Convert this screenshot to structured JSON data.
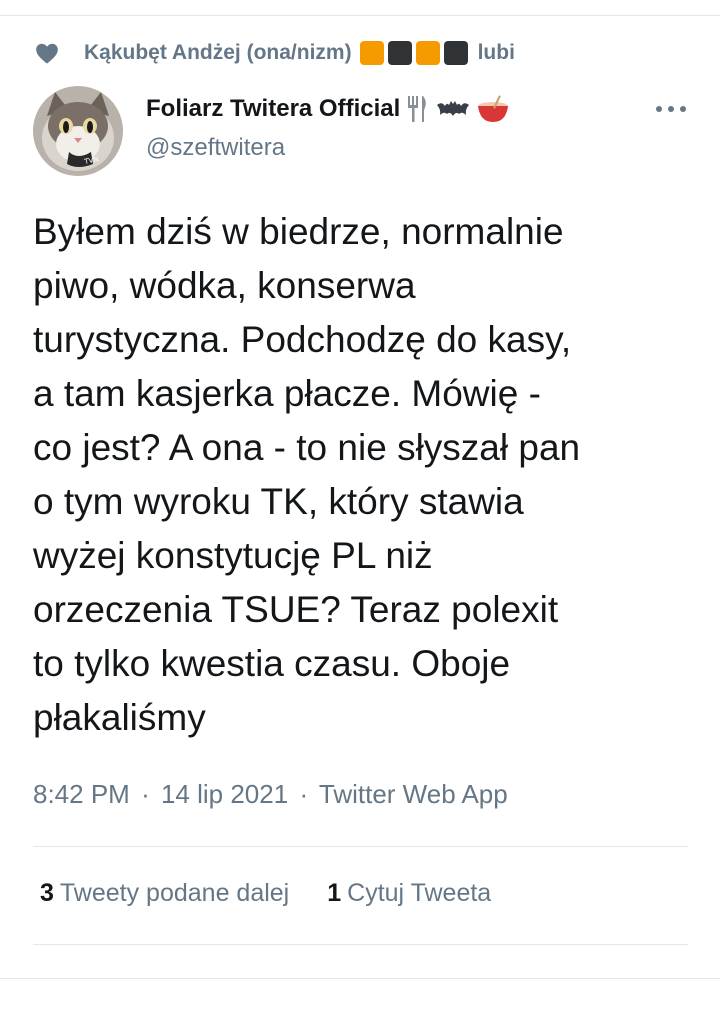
{
  "social_context": {
    "icon": "heart-icon",
    "user": "Kąkubęt Andżej (ona/nizm)",
    "squares": [
      "#f59b00",
      "#2f3336",
      "#f59b00",
      "#2f3336"
    ],
    "verb": "lubi"
  },
  "author": {
    "display_name": "Foliarz Twitera Official",
    "name_emojis": [
      "fork-knife-icon",
      "bat-icon",
      "bowl-icon"
    ],
    "handle": "@szeftwitera"
  },
  "tweet": {
    "text": "Byłem dziś w biedrze, normalnie\npiwo, wódka, konserwa\nturystyczna. Podchodzę do kasy,\na tam kasjerka płacze. Mówię -\nco jest? A ona - to nie słyszał pan\no tym wyroku TK, który stawia\nwyżej konstytucję PL niż\norzeczenia TSUE? Teraz polexit\nto tylko kwestia czasu. Oboje\npłakaliśmy"
  },
  "meta": {
    "time": "8:42 PM",
    "date": "14 lip 2021",
    "source": "Twitter Web App",
    "separator": "·"
  },
  "stats": {
    "retweets_count": "3",
    "retweets_label": "Tweety podane dalej",
    "quotes_count": "1",
    "quotes_label": "Cytuj Tweeta"
  },
  "colors": {
    "text": "#14171a",
    "secondary": "#657786",
    "divider": "#e1e8ed"
  }
}
